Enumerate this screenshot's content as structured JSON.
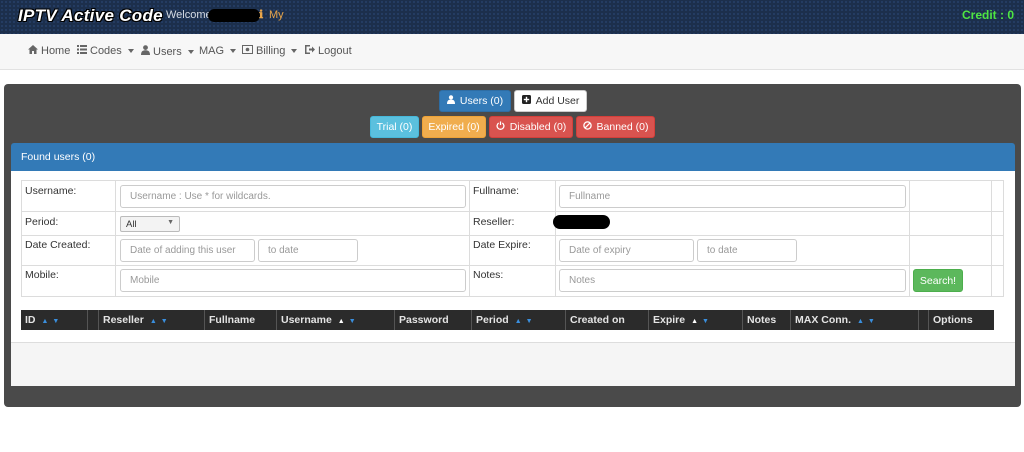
{
  "header": {
    "brand": "IPTV Active Code",
    "welcome": "Welcome",
    "my_link": "My",
    "credit": "Credit : 0"
  },
  "nav": {
    "home": "Home",
    "codes": "Codes",
    "users": "Users",
    "mag": "MAG",
    "billing": "Billing",
    "logout": "Logout"
  },
  "actions": {
    "users": "Users (0)",
    "add_user": "Add User",
    "trial": "Trial (0)",
    "expired": "Expired (0)",
    "disabled": "Disabled (0)",
    "banned": "Banned (0)"
  },
  "found": {
    "title": "Found users (0)"
  },
  "search": {
    "username_label": "Username:",
    "username_placeholder": "Username : Use * for wildcards.",
    "fullname_label": "Fullname:",
    "fullname_placeholder": "Fullname",
    "period_label": "Period:",
    "period_value": "All",
    "reseller_label": "Reseller:",
    "date_created_label": "Date Created:",
    "date_created_placeholder": "Date of adding this user",
    "to_date_placeholder": "to date",
    "date_expire_label": "Date Expire:",
    "date_expire_placeholder": "Date of expiry",
    "mobile_label": "Mobile:",
    "mobile_placeholder": "Mobile",
    "notes_label": "Notes:",
    "notes_placeholder": "Notes",
    "search_button": "Search!"
  },
  "table": {
    "columns": [
      "ID",
      "Reseller",
      "Fullname",
      "Username",
      "Password",
      "Period",
      "Created on",
      "Expire",
      "Notes",
      "MAX Conn.",
      "Options"
    ]
  },
  "colors": {
    "primary": "#337ab7",
    "info": "#5bc0de",
    "warning": "#f0ad4e",
    "danger": "#d9534f",
    "success": "#5cb85c",
    "credit": "#4ee542"
  }
}
